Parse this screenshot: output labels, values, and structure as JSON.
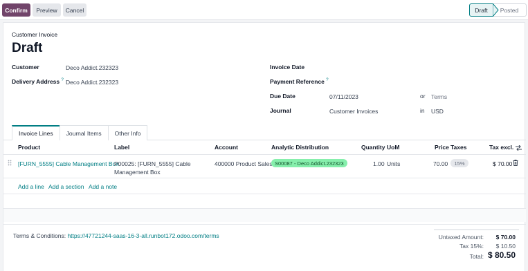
{
  "actions": {
    "confirm_label": "Confirm",
    "preview_label": "Preview",
    "cancel_label": "Cancel"
  },
  "statusbar": {
    "current": "Draft",
    "next": "Posted"
  },
  "colors": {
    "primary": "#71446a",
    "accent": "#017e84",
    "analytic_tag_bg": "#86efac",
    "tax_tag_bg": "#e5e7eb"
  },
  "invoice": {
    "type_label": "Customer Invoice",
    "state": "Draft",
    "customer_label": "Customer",
    "customer_value": "Deco Addict.232323",
    "delivery_label": "Delivery Address",
    "delivery_help": "?",
    "delivery_value": "Deco Addict.232323",
    "invoice_date_label": "Invoice Date",
    "payment_ref_label": "Payment Reference",
    "payment_ref_help": "?",
    "due_date_label": "Due Date",
    "due_date_value": "07/11/2023",
    "or_label": "or",
    "terms_label": "Terms",
    "journal_label": "Journal",
    "journal_value": "Customer Invoices",
    "in_label": "in",
    "currency_value": "USD"
  },
  "tabs": [
    {
      "label": "Invoice Lines"
    },
    {
      "label": "Journal Items"
    },
    {
      "label": "Other Info"
    }
  ],
  "lines": {
    "headers": {
      "product": "Product",
      "label": "Label",
      "account": "Account",
      "analytic": "Analytic Distribution",
      "quantity": "Quantity",
      "uom": "UoM",
      "price": "Price",
      "taxes": "Taxes",
      "tax_excl": "Tax excl."
    },
    "rows": [
      {
        "product": "[FURN_5555] Cable Management Box",
        "label_line1": "P00025: [FURN_5555] Cable",
        "label_line2": "Management Box",
        "account": "400000 Product Sales",
        "analytic": "S00087 - Deco Addict.232323",
        "quantity": "1.00",
        "uom": "Units",
        "price": "70.00",
        "tax": "15%",
        "subtotal": "$ 70.00"
      }
    ],
    "add_line": "Add a line",
    "add_section": "Add a section",
    "add_note": "Add a note"
  },
  "footer": {
    "terms_prefix": "Terms & Conditions:",
    "terms_link": "https://47721244-saas-16-3-all.runbot172.odoo.com/terms",
    "untaxed_label": "Untaxed Amount:",
    "untaxed_value": "$ 70.00",
    "tax_label": "Tax 15%:",
    "tax_value": "$ 10.50",
    "total_label": "Total:",
    "total_value": "$ 80.50"
  }
}
